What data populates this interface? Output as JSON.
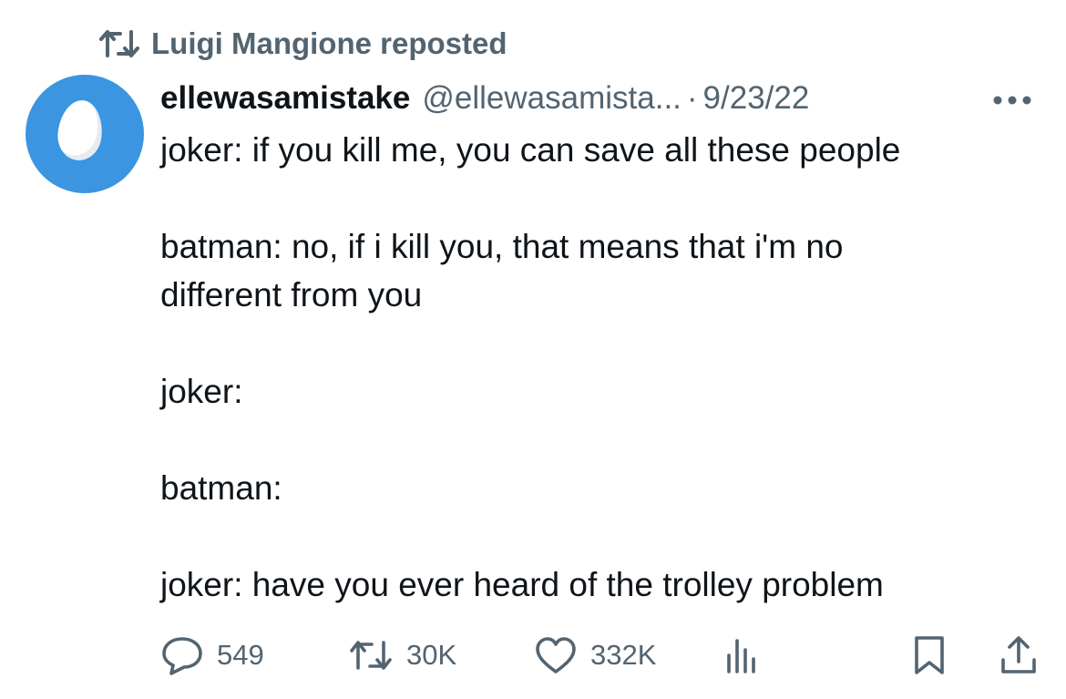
{
  "repost": {
    "label": "Luigi Mangione reposted",
    "icon": "repost-icon"
  },
  "author": {
    "display_name": "ellewasamistake",
    "handle": "@ellewasamista...",
    "separator": "·",
    "date": "9/23/22",
    "avatar": "default-egg-avatar",
    "avatar_color": "#3b95e0"
  },
  "tweet": {
    "lines": [
      "joker: if you kill me, you can save all these people",
      "",
      "batman: no, if i kill you, that means that i'm no",
      "different from you",
      "",
      "joker:",
      "",
      "batman:",
      "",
      "joker: have you ever heard of the trolley problem"
    ]
  },
  "actions": {
    "replies": {
      "count": "549",
      "icon": "reply-icon"
    },
    "reposts": {
      "count": "30K",
      "icon": "repost-icon"
    },
    "likes": {
      "count": "332K",
      "icon": "heart-icon"
    },
    "views": {
      "icon": "views-chart-icon"
    },
    "bookmark": {
      "icon": "bookmark-icon"
    },
    "share": {
      "icon": "share-icon"
    }
  },
  "colors": {
    "text_primary": "#0f1419",
    "text_secondary": "#536471",
    "background": "#ffffff"
  }
}
